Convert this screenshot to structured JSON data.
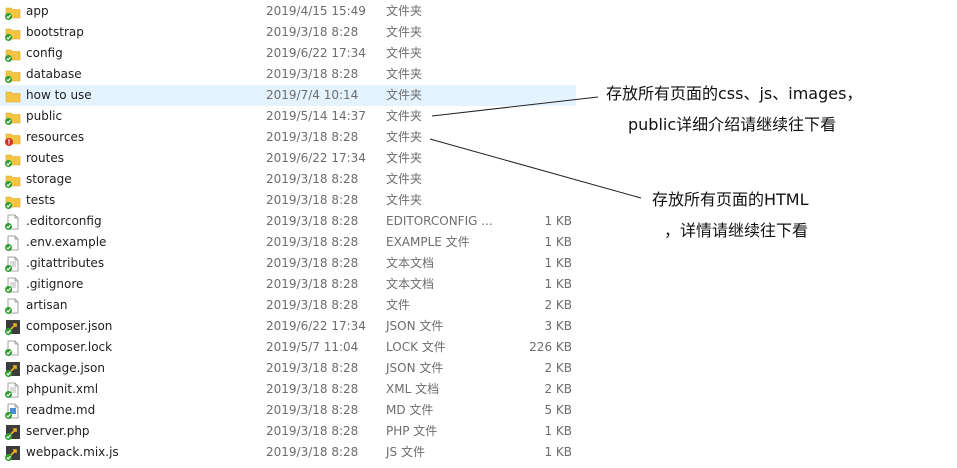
{
  "files": [
    {
      "name": "app",
      "date": "2019/4/15 15:49",
      "type": "文件夹",
      "size": "",
      "icon": "folder-synced-icon",
      "selected": false
    },
    {
      "name": "bootstrap",
      "date": "2019/3/18 8:28",
      "type": "文件夹",
      "size": "",
      "icon": "folder-synced-icon",
      "selected": false
    },
    {
      "name": "config",
      "date": "2019/6/22 17:34",
      "type": "文件夹",
      "size": "",
      "icon": "folder-synced-icon",
      "selected": false
    },
    {
      "name": "database",
      "date": "2019/3/18 8:28",
      "type": "文件夹",
      "size": "",
      "icon": "folder-synced-icon",
      "selected": false
    },
    {
      "name": "how to use",
      "date": "2019/7/4 10:14",
      "type": "文件夹",
      "size": "",
      "icon": "folder-icon",
      "selected": true
    },
    {
      "name": "public",
      "date": "2019/5/14 14:37",
      "type": "文件夹",
      "size": "",
      "icon": "folder-synced-icon",
      "selected": false
    },
    {
      "name": "resources",
      "date": "2019/3/18 8:28",
      "type": "文件夹",
      "size": "",
      "icon": "folder-error-icon",
      "selected": false
    },
    {
      "name": "routes",
      "date": "2019/6/22 17:34",
      "type": "文件夹",
      "size": "",
      "icon": "folder-synced-icon",
      "selected": false
    },
    {
      "name": "storage",
      "date": "2019/3/18 8:28",
      "type": "文件夹",
      "size": "",
      "icon": "folder-synced-icon",
      "selected": false
    },
    {
      "name": "tests",
      "date": "2019/3/18 8:28",
      "type": "文件夹",
      "size": "",
      "icon": "folder-synced-icon",
      "selected": false
    },
    {
      "name": ".editorconfig",
      "date": "2019/3/18 8:28",
      "type": "EDITORCONFIG ...",
      "size": "1 KB",
      "icon": "file-synced-icon",
      "selected": false
    },
    {
      "name": ".env.example",
      "date": "2019/3/18 8:28",
      "type": "EXAMPLE 文件",
      "size": "1 KB",
      "icon": "file-synced-icon",
      "selected": false
    },
    {
      "name": ".gitattributes",
      "date": "2019/3/18 8:28",
      "type": "文本文档",
      "size": "1 KB",
      "icon": "text-file-synced-icon",
      "selected": false
    },
    {
      "name": ".gitignore",
      "date": "2019/3/18 8:28",
      "type": "文本文档",
      "size": "1 KB",
      "icon": "text-file-synced-icon",
      "selected": false
    },
    {
      "name": "artisan",
      "date": "2019/3/18 8:28",
      "type": "文件",
      "size": "2 KB",
      "icon": "file-synced-icon",
      "selected": false
    },
    {
      "name": "composer.json",
      "date": "2019/6/22 17:34",
      "type": "JSON 文件",
      "size": "3 KB",
      "icon": "code-file-synced-icon",
      "selected": false
    },
    {
      "name": "composer.lock",
      "date": "2019/5/7 11:04",
      "type": "LOCK 文件",
      "size": "226 KB",
      "icon": "file-synced-icon",
      "selected": false
    },
    {
      "name": "package.json",
      "date": "2019/3/18 8:28",
      "type": "JSON 文件",
      "size": "2 KB",
      "icon": "code-file-synced-icon",
      "selected": false
    },
    {
      "name": "phpunit.xml",
      "date": "2019/3/18 8:28",
      "type": "XML 文档",
      "size": "2 KB",
      "icon": "text-file-synced-icon",
      "selected": false
    },
    {
      "name": "readme.md",
      "date": "2019/3/18 8:28",
      "type": "MD 文件",
      "size": "5 KB",
      "icon": "image-file-synced-icon",
      "selected": false
    },
    {
      "name": "server.php",
      "date": "2019/3/18 8:28",
      "type": "PHP 文件",
      "size": "1 KB",
      "icon": "code-file-synced-icon",
      "selected": false
    },
    {
      "name": "webpack.mix.js",
      "date": "2019/3/18 8:28",
      "type": "JS 文件",
      "size": "1 KB",
      "icon": "code-file-synced-icon",
      "selected": false
    }
  ],
  "annotations": {
    "public_line1": "存放所有页面的css、js、images，",
    "public_line2": "public详细介绍请继续往下看",
    "resources_line1": "存放所有页面的HTML",
    "resources_line2": "，详情请继续往下看"
  },
  "colors": {
    "folder": "#f5c542",
    "sync_check": "#2a9d2a",
    "error_badge": "#d93025",
    "selection": "#e5f3ff",
    "secondary_text": "#6d6d6d"
  }
}
